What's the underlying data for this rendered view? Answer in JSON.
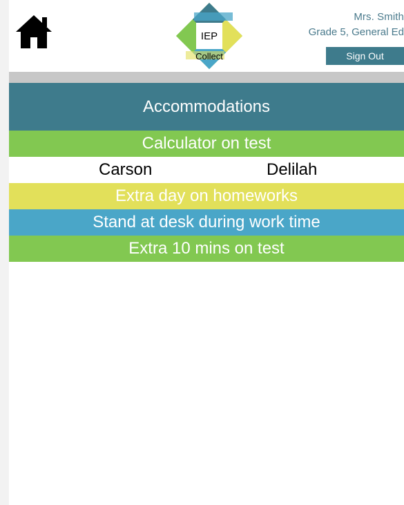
{
  "header": {
    "logo": {
      "line1": "IEP",
      "line2": "Collect"
    },
    "user": {
      "name": "Mrs. Smith",
      "grade": "Grade 5, General Ed"
    },
    "signout_label": "Sign Out",
    "home_icon": "home-icon"
  },
  "colors": {
    "teal": "#3e7b8c",
    "green": "#82c851",
    "yellow": "#e2e05a",
    "blue": "#4aa6c8",
    "divider": "#c7c7c7"
  },
  "main": {
    "title": "Accommodations",
    "accommodations": [
      {
        "label": "Calculator on test",
        "color": "green",
        "students": [
          "Carson",
          "Delilah"
        ]
      },
      {
        "label": "Extra day on homeworks",
        "color": "yellow"
      },
      {
        "label": "Stand at desk during work time",
        "color": "blue"
      },
      {
        "label": "Extra 10 mins on test",
        "color": "green"
      }
    ]
  }
}
